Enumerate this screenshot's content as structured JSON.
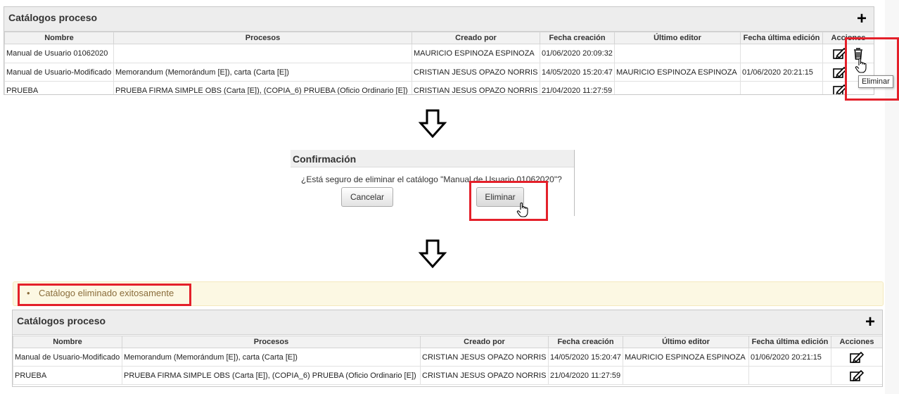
{
  "top_panel": {
    "title": "Catálogos proceso",
    "columns": [
      "Nombre",
      "Procesos",
      "Creado por",
      "Fecha creación",
      "Último editor",
      "Fecha última edición",
      "Acciones"
    ],
    "rows": [
      {
        "nombre": "Manual de Usuario 01062020",
        "procesos": "",
        "creado": "MAURICIO ESPINOZA ESPINOZA",
        "fecha": "01/06/2020 20:09:32",
        "editor": "",
        "fecha_edicion": ""
      },
      {
        "nombre": "Manual de Usuario-Modificado",
        "procesos": "Memorandum (Memorándum [E]), carta (Carta [E])",
        "creado": "CRISTIAN JESUS OPAZO NORRIS",
        "fecha": "14/05/2020 15:20:47",
        "editor": "MAURICIO ESPINOZA ESPINOZA",
        "fecha_edicion": "01/06/2020 20:21:15"
      },
      {
        "nombre": "PRUEBA",
        "procesos": "PRUEBA FIRMA SIMPLE OBS (Carta [E]), (COPIA_6) PRUEBA (Oficio Ordinario [E])",
        "creado": "CRISTIAN JESUS OPAZO NORRIS",
        "fecha": "21/04/2020 11:27:59",
        "editor": "",
        "fecha_edicion": ""
      }
    ],
    "tooltip": "Eliminar"
  },
  "dialog": {
    "title": "Confirmación",
    "message": "¿Está seguro de eliminar el catálogo \"Manual de Usuario 01062020\"?",
    "cancel_label": "Cancelar",
    "delete_label": "Eliminar"
  },
  "flash": {
    "message": "Catálogo eliminado exitosamente"
  },
  "bottom_panel": {
    "title": "Catálogos proceso",
    "columns": [
      "Nombre",
      "Procesos",
      "Creado por",
      "Fecha creación",
      "Último editor",
      "Fecha última edición",
      "Acciones"
    ],
    "rows": [
      {
        "nombre": "Manual de Usuario-Modificado",
        "procesos": "Memorandum (Memorándum [E]), carta (Carta [E])",
        "creado": "CRISTIAN JESUS OPAZO NORRIS",
        "fecha": "14/05/2020 15:20:47",
        "editor": "MAURICIO ESPINOZA ESPINOZA",
        "fecha_edicion": "01/06/2020 20:21:15"
      },
      {
        "nombre": "PRUEBA",
        "procesos": "PRUEBA FIRMA SIMPLE OBS (Carta [E]), (COPIA_6) PRUEBA (Oficio Ordinario [E])",
        "creado": "CRISTIAN JESUS OPAZO NORRIS",
        "fecha": "21/04/2020 11:27:59",
        "editor": "",
        "fecha_edicion": ""
      }
    ]
  },
  "colors": {
    "highlight": "#e4202a",
    "flash_bg": "#fcf8e3",
    "flash_text": "#8a6d3b"
  },
  "icons": [
    "plus-icon",
    "edit-icon",
    "trash-icon",
    "hand-cursor-icon",
    "down-arrow-icon"
  ]
}
